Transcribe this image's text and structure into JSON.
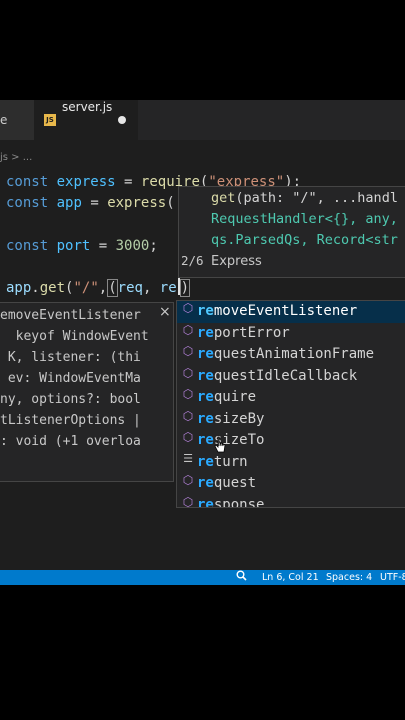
{
  "tabs": {
    "left_partial": "e",
    "active_icon": "JS",
    "active_title": "server.js"
  },
  "breadcrumb": "js > ...",
  "code": {
    "line1": {
      "kw": "const",
      "var": "express",
      "eq": " = ",
      "fn": "require",
      "open": "(",
      "str": "\"express\"",
      "close": ");"
    },
    "line2": {
      "kw": "const",
      "var": "app",
      "eq": " = ",
      "fn": "express",
      "open": "("
    },
    "line4": {
      "kw": "const",
      "var": "port",
      "eq": " = ",
      "num": "3000",
      "end": ";"
    },
    "line6": {
      "obj": "app",
      "dot": ".",
      "fn": "get",
      "open": "(",
      "str": "\"/\"",
      "comma": ",",
      "paren": "(",
      "p1": "req",
      "sep": ", ",
      "p2": "re",
      "close": ")"
    }
  },
  "hover": {
    "sig1_fn": "get",
    "sig1_rest": "(path: \"/\", ...handl",
    "sig2": "RequestHandler<{}, any,",
    "sig3": "qs.ParsedQs, Record<str",
    "counter": "2/6",
    "doc": "Express"
  },
  "params_widget": {
    "close_label": "×",
    "lines": [
      "emoveEventListener",
      "  keyof WindowEvent",
      " K, listener: (thi",
      " ev: WindowEventMa",
      "ny, options?: bool",
      "tListenerOptions |",
      ": void (+1 overloa"
    ]
  },
  "suggestions": [
    {
      "match": "re",
      "rest": "moveEventListener",
      "icon": "cube-icon"
    },
    {
      "match": "re",
      "rest": "portError",
      "icon": "cube-icon"
    },
    {
      "match": "re",
      "rest": "questAnimationFrame",
      "icon": "cube-icon"
    },
    {
      "match": "re",
      "rest": "questIdleCallback",
      "icon": "cube-icon"
    },
    {
      "match": "re",
      "rest": "quire",
      "icon": "cube-icon"
    },
    {
      "match": "re",
      "rest": "sizeBy",
      "icon": "cube-icon"
    },
    {
      "match": "re",
      "rest": "sizeTo",
      "icon": "cube-icon"
    },
    {
      "match": "re",
      "rest": "turn",
      "icon": "keyword-icon"
    },
    {
      "match": "re",
      "rest": "quest",
      "icon": "cube-icon"
    },
    {
      "match": "re",
      "rest": "sponse",
      "icon": "cube-icon"
    }
  ],
  "status": {
    "position": "Ln 6, Col 21",
    "spaces": "Spaces: 4",
    "encoding": "UTF-8"
  },
  "colors": {
    "editor_bg": "#1e1e1e",
    "statusbar": "#007acc",
    "selected_suggestion": "#062f4a",
    "match_highlight": "#2aaaff"
  }
}
